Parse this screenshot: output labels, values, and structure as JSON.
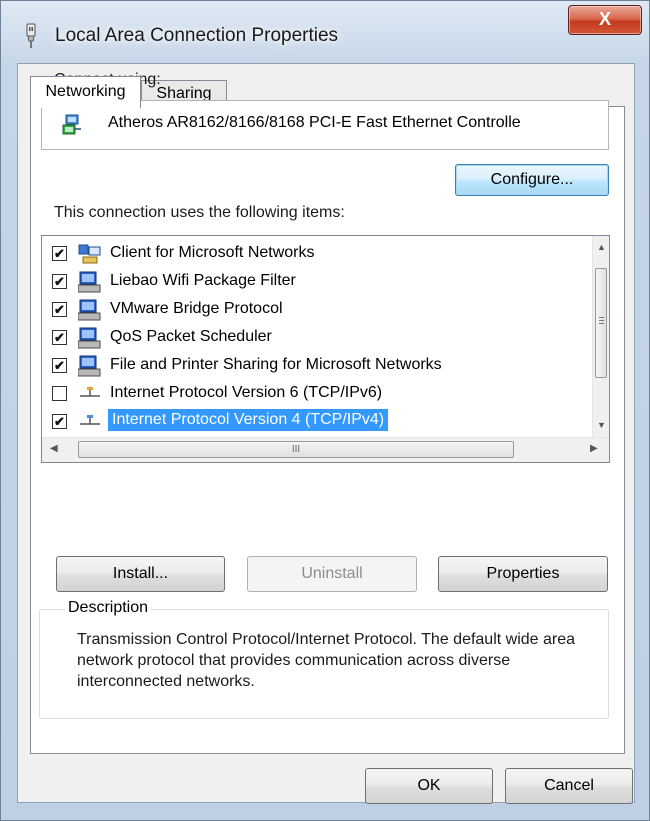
{
  "window": {
    "title": "Local Area Connection Properties",
    "close_glyph": "X"
  },
  "tabs": [
    {
      "label": "Networking",
      "active": true
    },
    {
      "label": "Sharing",
      "active": false
    }
  ],
  "connect_using": {
    "label": "Connect using:",
    "adapter_name": "Atheros AR8162/8166/8168 PCI-E Fast Ethernet Controlle",
    "adapter_icon": "network-adapter-icon",
    "configure_label": "Configure..."
  },
  "items_section": {
    "label": "This connection uses the following items:",
    "items": [
      {
        "label": "Client for Microsoft Networks",
        "checked": true,
        "icon": "client-network-icon",
        "selected": false
      },
      {
        "label": "Liebao Wifi Package Filter",
        "checked": true,
        "icon": "network-service-icon",
        "selected": false
      },
      {
        "label": "VMware Bridge Protocol",
        "checked": true,
        "icon": "network-service-icon",
        "selected": false
      },
      {
        "label": "QoS Packet Scheduler",
        "checked": true,
        "icon": "network-service-icon",
        "selected": false
      },
      {
        "label": "File and Printer Sharing for Microsoft Networks",
        "checked": true,
        "icon": "network-service-icon",
        "selected": false
      },
      {
        "label": "Internet Protocol Version 6 (TCP/IPv6)",
        "checked": false,
        "icon": "protocol-icon",
        "selected": false
      },
      {
        "label": "Internet Protocol Version 4 (TCP/IPv4)",
        "checked": true,
        "icon": "protocol-icon",
        "selected": true
      }
    ],
    "hscroll_grip": "III"
  },
  "actions": {
    "install_label": "Install...",
    "uninstall_label": "Uninstall",
    "properties_label": "Properties"
  },
  "description": {
    "legend": "Description",
    "text": "Transmission Control Protocol/Internet Protocol. The default wide area network protocol that provides communication across diverse interconnected networks."
  },
  "footer": {
    "ok_label": "OK",
    "cancel_label": "Cancel"
  },
  "colors": {
    "selection": "#3399ff",
    "close_button": "#c23b1e",
    "window_frame": "#bfd0e4"
  }
}
